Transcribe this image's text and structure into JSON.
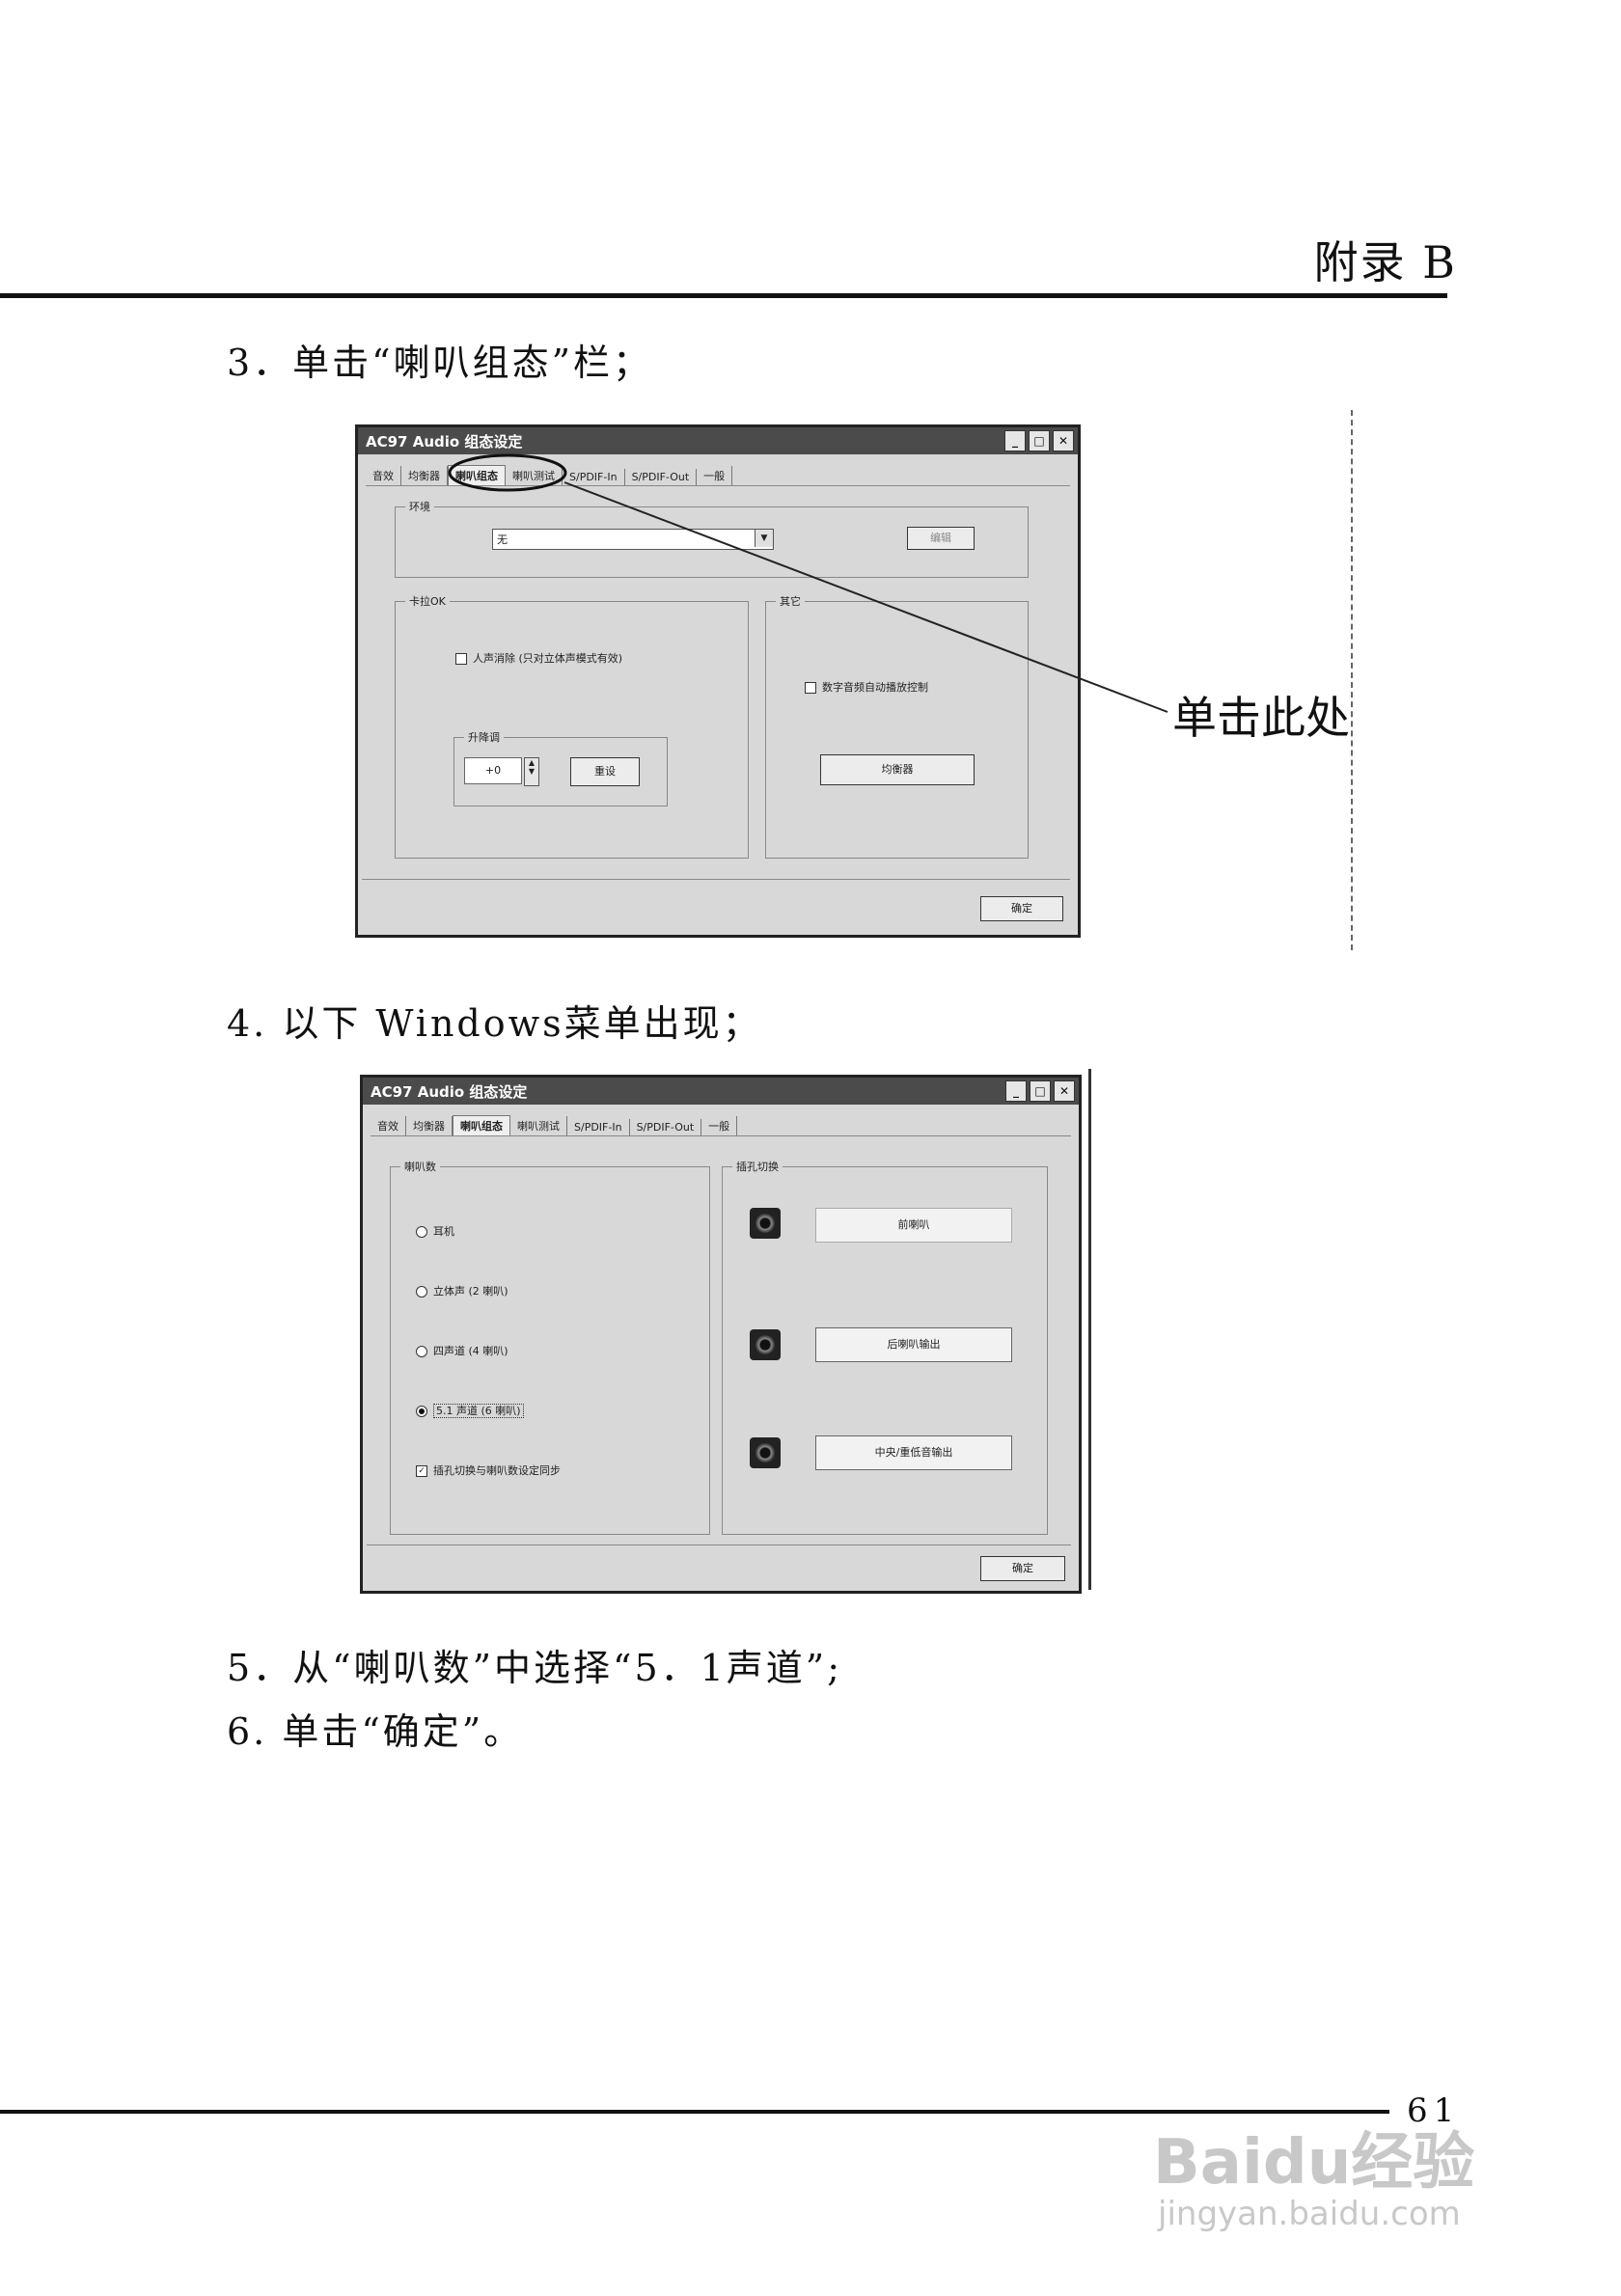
{
  "header": {
    "title": "附录 B"
  },
  "steps": {
    "s3": "3．单击“喇叭组态”栏；",
    "s4": "4. 以下 Windows菜单出现；",
    "s5": "5．从“喇叭数”中选择“5．1声道”;",
    "s6": "6. 单击“确定”。"
  },
  "callout": {
    "text": "单击此处"
  },
  "window1": {
    "title": "AC97 Audio 组态设定",
    "tabs": [
      "音效",
      "均衡器",
      "喇叭组态",
      "喇叭测试",
      "S/PDIF-In",
      "S/PDIF-Out",
      "一般"
    ],
    "env_group": "环境",
    "env_value": "无",
    "edit_btn": "编辑",
    "karaoke_group": "卡拉OK",
    "voice_cancel": "人声消除 (只对立体声模式有效)",
    "key_group": "升降调",
    "key_value": "+0",
    "reset_btn": "重设",
    "other_group": "其它",
    "digital_check": "数字音频自动播放控制",
    "eq_btn": "均衡器",
    "ok_btn": "确定"
  },
  "window2": {
    "title": "AC97 Audio 组态设定",
    "tabs": [
      "音效",
      "均衡器",
      "喇叭组态",
      "喇叭测试",
      "S/PDIF-In",
      "S/PDIF-Out",
      "一般"
    ],
    "speakers_group": "喇叭数",
    "options": [
      "耳机",
      "立体声 (2 喇叭)",
      "四声道 (4 喇叭)",
      "5.1 声道 (6 喇叭)"
    ],
    "sync_check": "插孔切换与喇叭数设定同步",
    "jack_group": "插孔切换",
    "jack_labels": [
      "前喇叭",
      "后喇叭输出",
      "中央/重低音输出"
    ],
    "ok_btn": "确定"
  },
  "footer": {
    "page": "61"
  },
  "watermark": {
    "brand": "Baidu经验",
    "url": "jingyan.baidu.com"
  }
}
